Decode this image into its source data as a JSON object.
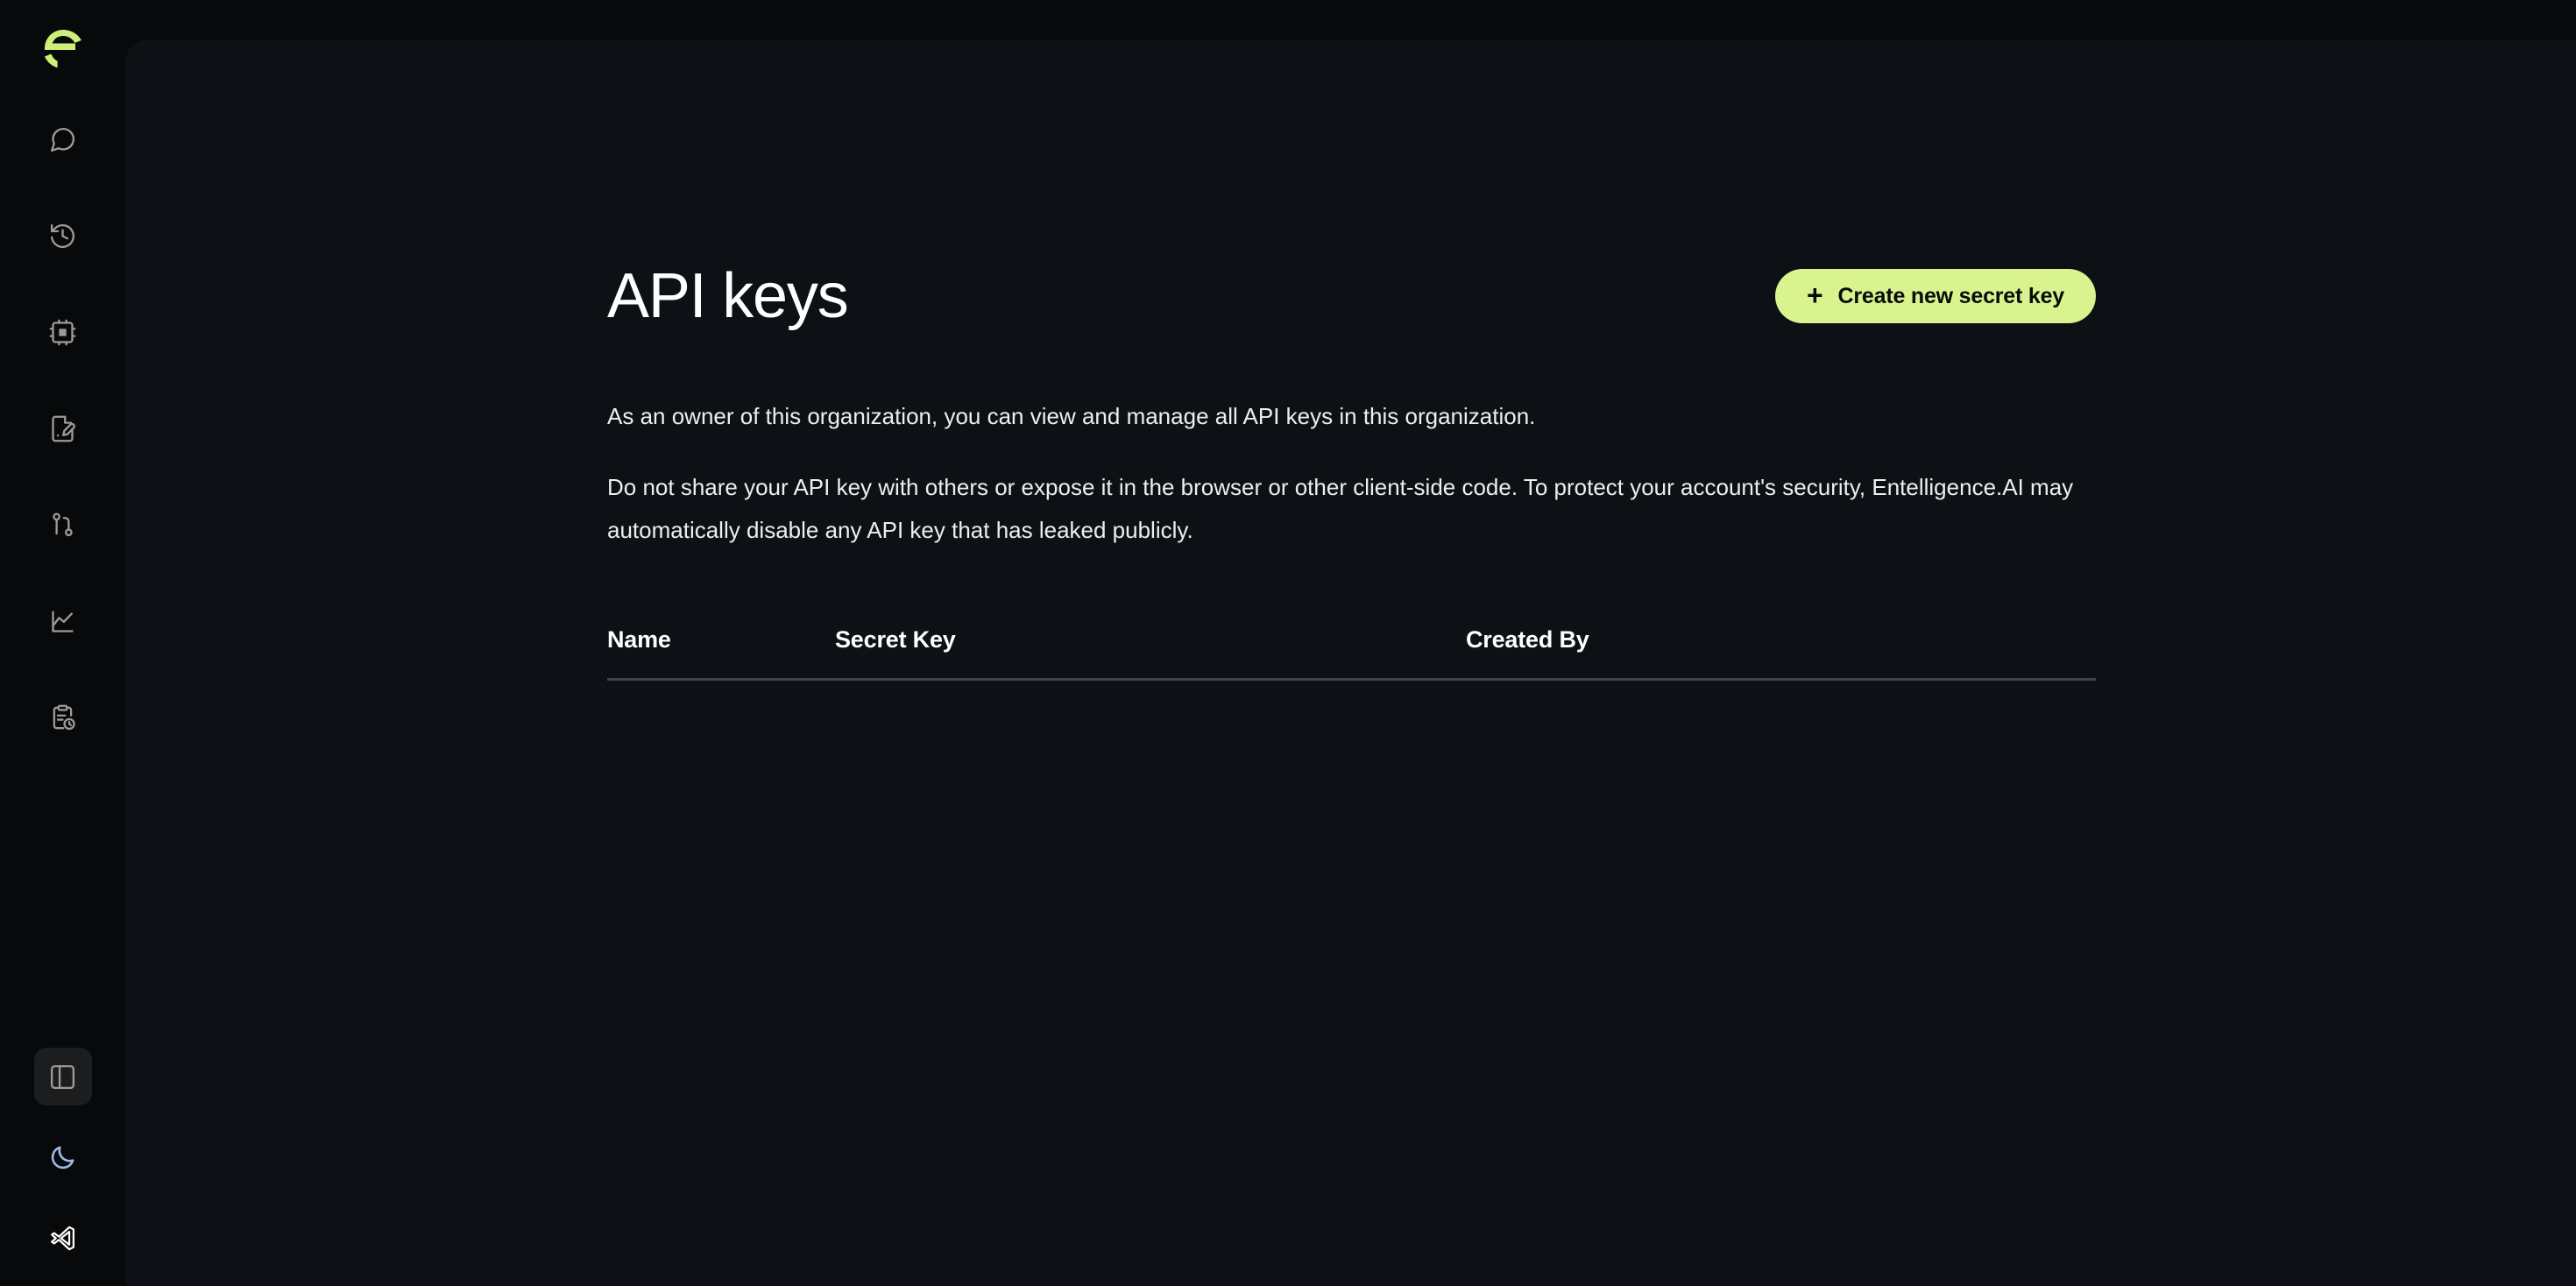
{
  "app": {
    "logo_name": "entelligence-e-logo",
    "brand_color": "#cdef7a",
    "accent_color": "#d9f48f",
    "sidebar_bg": "#08090a",
    "panel_bg": "#0d1115"
  },
  "sidebar": {
    "top_items": [
      {
        "name": "chat",
        "icon": "chat-bubble-icon",
        "label": "Chat"
      },
      {
        "name": "history",
        "icon": "history-clock-icon",
        "label": "History"
      },
      {
        "name": "agents",
        "icon": "cpu-chip-icon",
        "label": "Agents"
      },
      {
        "name": "docs",
        "icon": "file-pen-icon",
        "label": "Docs"
      },
      {
        "name": "pull-requests",
        "icon": "git-branch-icon",
        "label": "Pull Requests"
      },
      {
        "name": "analytics",
        "icon": "line-chart-icon",
        "label": "Analytics"
      },
      {
        "name": "reports",
        "icon": "clipboard-clock-icon",
        "label": "Reports"
      }
    ],
    "bottom_items": [
      {
        "name": "toggle-sidebar",
        "icon": "panel-left-icon",
        "label": "Toggle sidebar",
        "active": true
      },
      {
        "name": "theme-toggle",
        "icon": "moon-icon",
        "label": "Dark mode",
        "color": "#9cbce8"
      },
      {
        "name": "vscode-extension",
        "icon": "vscode-icon",
        "label": "VS Code",
        "color": "#ffffff"
      }
    ]
  },
  "page": {
    "title": "API keys",
    "create_button": {
      "label": "Create new secret key",
      "plus": "+",
      "icon": "plus-icon"
    },
    "description_1": "As an owner of this organization, you can view and manage all API keys in this organization.",
    "description_2": "Do not share your API key with others or expose it in the browser or other client-side code. To protect your account's security, Entelligence.AI may automatically disable any API key that has leaked publicly."
  },
  "table": {
    "columns": [
      {
        "key": "name",
        "label": "Name"
      },
      {
        "key": "secret_key",
        "label": "Secret Key"
      },
      {
        "key": "created_by",
        "label": "Created By"
      }
    ],
    "rows": []
  }
}
